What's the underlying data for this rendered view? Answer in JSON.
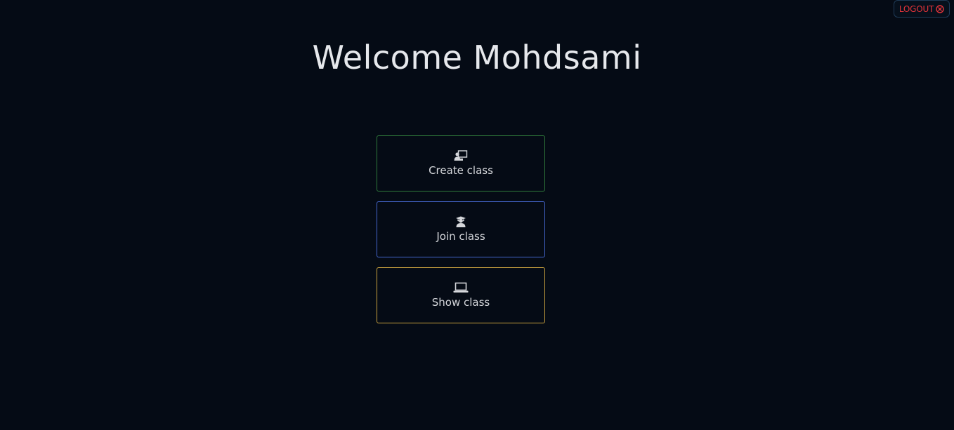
{
  "header": {
    "logout_label": "LOGOUT",
    "logout_icon": "circle-x-icon"
  },
  "main": {
    "title": "Welcome Mohdsami",
    "actions": [
      {
        "label": "Create class",
        "icon": "teacher-board-icon",
        "border_color": "#2f7a3b"
      },
      {
        "label": "Join class",
        "icon": "graduate-student-icon",
        "border_color": "#4466cc"
      },
      {
        "label": "Show class",
        "icon": "laptop-icon",
        "border_color": "#c9a13e"
      }
    ]
  },
  "colors": {
    "background": "#050b15",
    "text": "#e6e8ec",
    "logout": "#e8343a"
  }
}
